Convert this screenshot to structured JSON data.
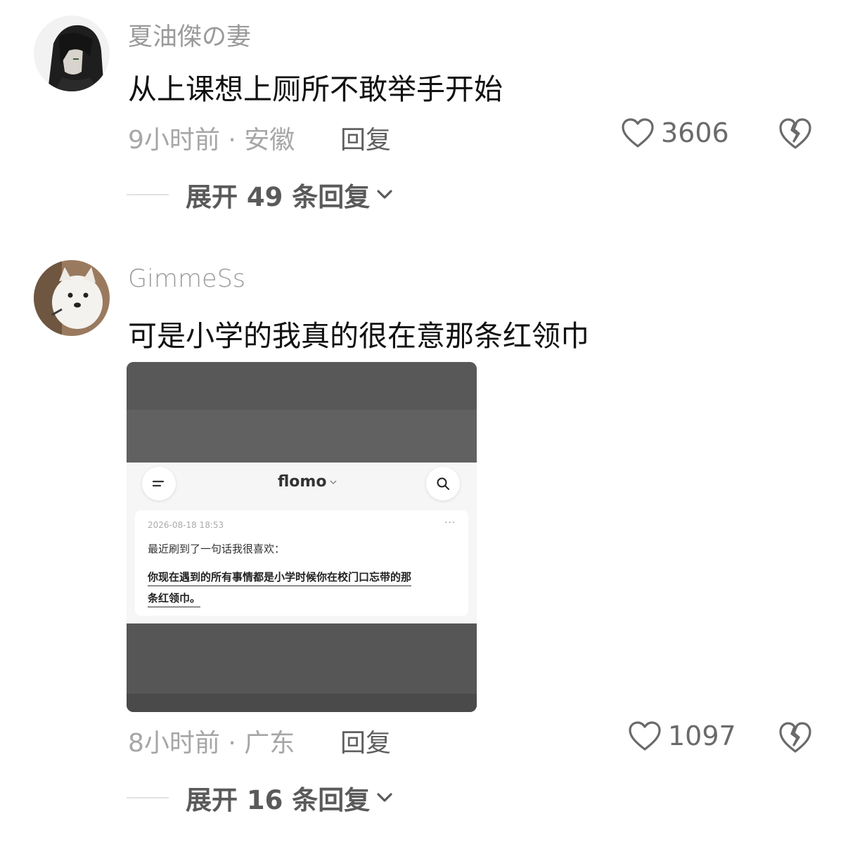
{
  "comments": [
    {
      "username": "夏油傑の妻",
      "text": "从上课想上厕所不敢举手开始",
      "meta": "9小时前 · 安徽",
      "reply_label": "回复",
      "likes": "3606",
      "expand_label": "展开 49 条回复"
    },
    {
      "username": "GimmeSs",
      "text": "可是小学的我真的很在意那条红领巾",
      "meta": "8小时前 · 广东",
      "reply_label": "回复",
      "likes": "1097",
      "expand_label": "展开 16 条回复",
      "attachment": {
        "app_title": "flomo",
        "memo_date": "2026-08-18 18:53",
        "memo_more": "···",
        "memo_line1": "最近刷到了一句话我很喜欢：",
        "memo_line2": "你现在遇到的所有事情都是小学时候你在校门口忘带的那",
        "memo_line3": "条红领巾。"
      }
    }
  ],
  "icons": {
    "like": "heart-outline-icon",
    "dislike": "broken-heart-icon",
    "expand": "chevron-down-icon"
  },
  "colors": {
    "username": "#9a9a9a",
    "text": "#111111",
    "meta": "#a6a6a6"
  }
}
